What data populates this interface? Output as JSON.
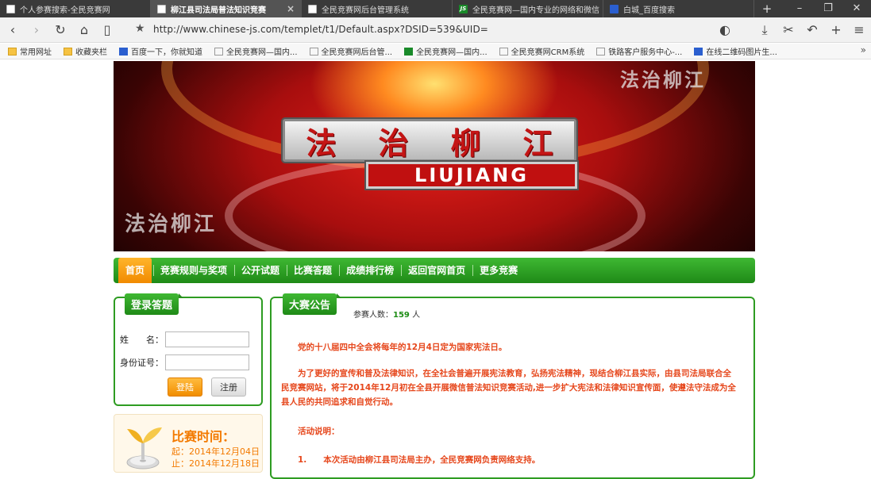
{
  "browser": {
    "tabs": [
      {
        "title": "个人参赛搜索-全民竞赛网",
        "active": false,
        "icon": "page-icon"
      },
      {
        "title": "柳江县司法局普法知识竞赛",
        "active": true,
        "icon": "page-icon"
      },
      {
        "title": "全民竞赛网后台管理系统",
        "active": false,
        "icon": "page-icon"
      },
      {
        "title": "全民竞赛网—国内专业的网络和微信",
        "active": false,
        "icon": "js-logo-icon"
      },
      {
        "title": "白城_百度搜索",
        "active": false,
        "icon": "baidu-paw-icon"
      }
    ],
    "url": "http://www.chinese-js.com/templet/t1/Default.aspx?DSID=539&UID=",
    "bookmarks": [
      {
        "label": "常用网址",
        "icon": "folder-icon"
      },
      {
        "label": "收藏夹栏",
        "icon": "folder-icon"
      },
      {
        "label": "百度一下，你就知道",
        "icon": "baidu-paw-icon"
      },
      {
        "label": "全民竞赛网—国内...",
        "icon": "page-icon"
      },
      {
        "label": "全民竞赛网后台管...",
        "icon": "page-icon"
      },
      {
        "label": "全民竞赛网—国内...",
        "icon": "js-logo-icon"
      },
      {
        "label": "全民竞赛网CRM系统",
        "icon": "page-icon"
      },
      {
        "label": "铁路客户服务中心-...",
        "icon": "page-icon"
      },
      {
        "label": "在线二维码图片生...",
        "icon": "qr-icon"
      }
    ]
  },
  "banner": {
    "plate_chars": [
      "法",
      "治",
      "柳",
      "江"
    ],
    "plate_sub": "LIUJIANG",
    "watermark": "法治柳江"
  },
  "nav": {
    "items": [
      "首页",
      "竞赛规则与奖项",
      "公开试题",
      "比赛答题",
      "成绩排行榜",
      "返回官网首页",
      "更多竞赛"
    ]
  },
  "login": {
    "title": "登录答题",
    "name_label": "姓　　名：",
    "id_label": "身份证号：",
    "login_button": "登陆",
    "register_button": "注册"
  },
  "contest_time": {
    "title": "比赛时间：",
    "start": "起：2014年12月04日",
    "end": "止：2014年12月18日"
  },
  "notice": {
    "title": "大赛公告",
    "participants_label": "参赛人数：",
    "participants_count": "159",
    "participants_unit": "人",
    "paragraphs": [
      "党的十八届四中全会将每年的12月4日定为国家宪法日。",
      "为了更好的宣传和普及法律知识，在全社会普遍开展宪法教育，弘扬宪法精神，现结合柳江县实际，由县司法局联合全民竞赛网站，将于2014年12月初在全县开展微信普法知识竞赛活动,进一步扩大宪法和法律知识宣传面，使遵法守法成为全县人民的共同追求和自觉行动。",
      "活动说明：",
      "1.　　本次活动由柳江县司法局主办，全民竞赛网负责网络支持。"
    ]
  },
  "colors": {
    "nav_green": "#2e9c22",
    "nav_active_orange": "#f18a00",
    "notice_text": "#e6471c",
    "count_green": "#1e8d15"
  }
}
